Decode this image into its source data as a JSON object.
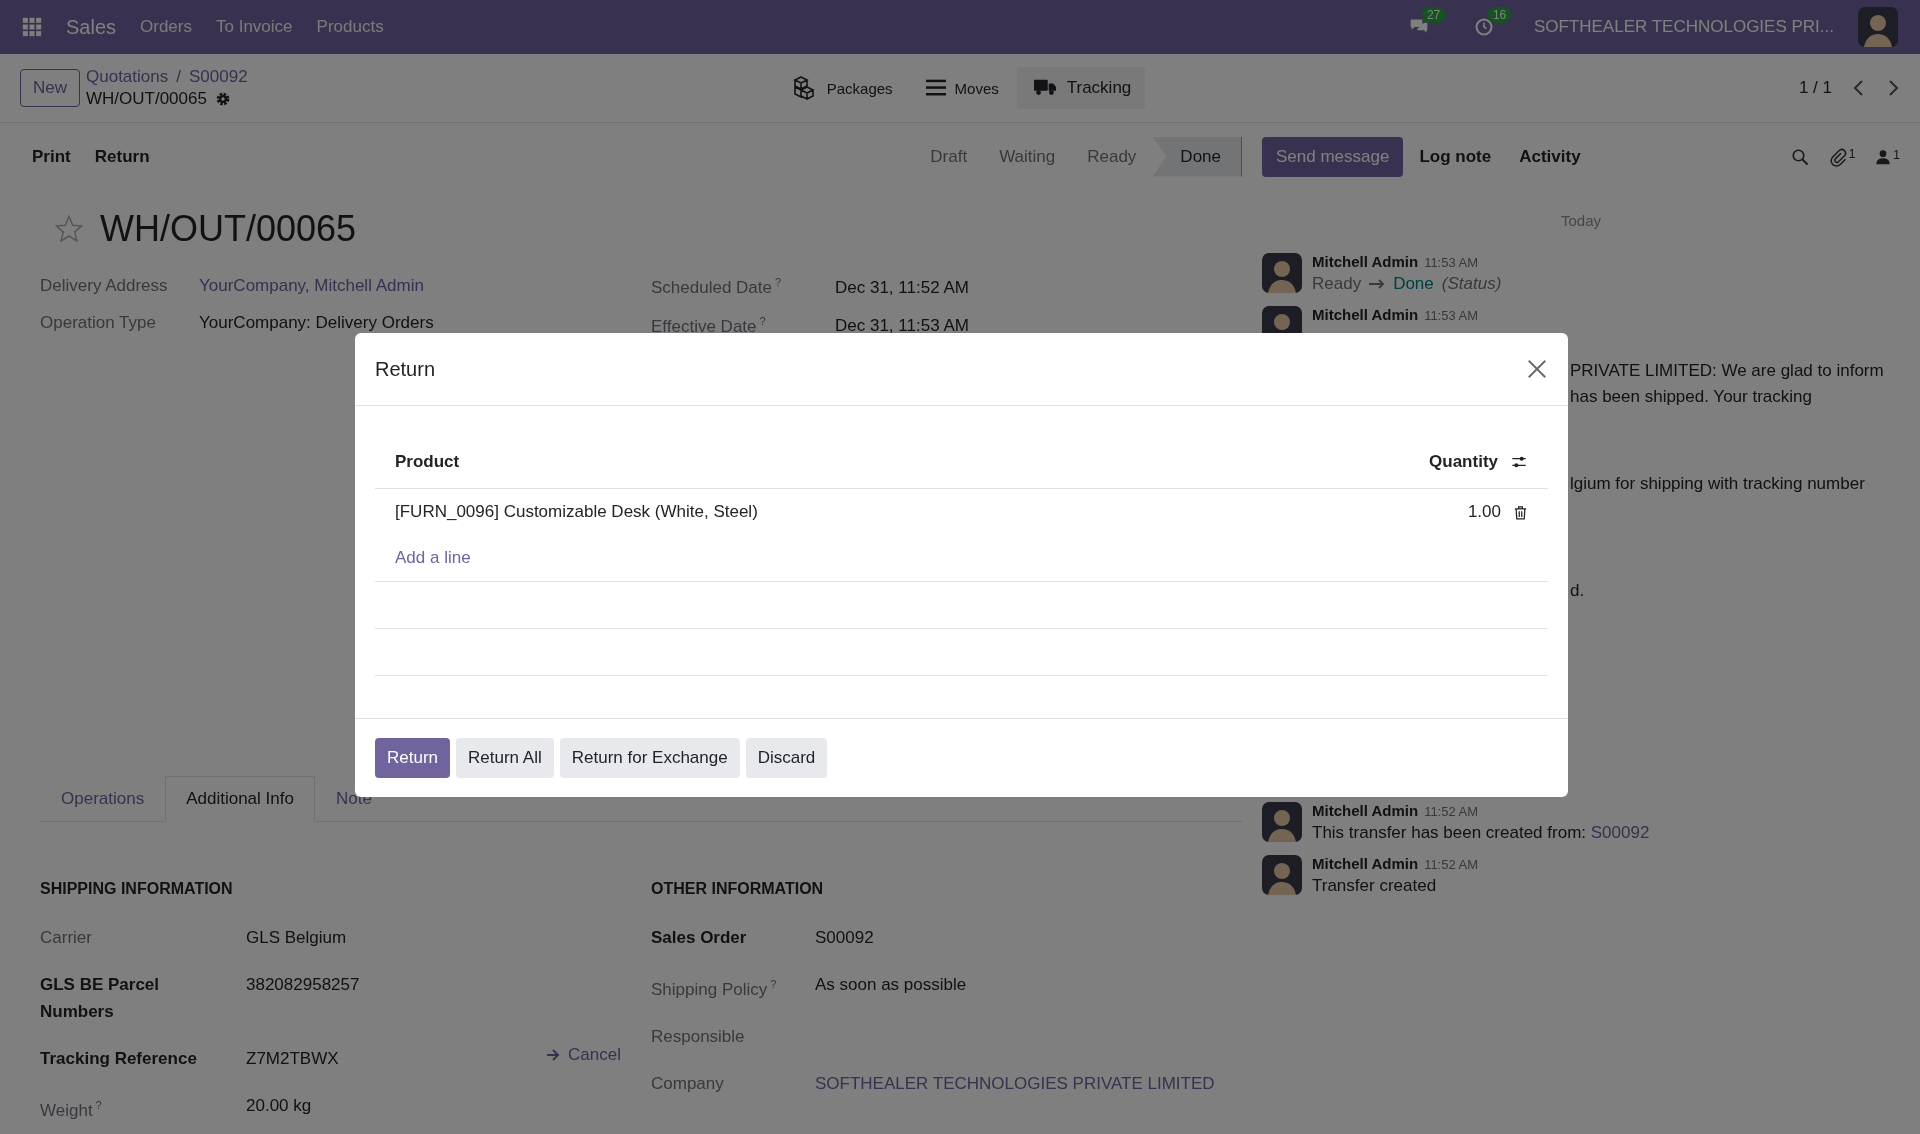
{
  "top_bar": {
    "app": "Sales",
    "menu": [
      "Orders",
      "To Invoice",
      "Products"
    ],
    "messages_badge": "27",
    "activities_badge": "16",
    "company": "SOFTHEALER TECHNOLOGIES PRI..."
  },
  "control_panel": {
    "new_button": "New",
    "breadcrumbs": [
      "Quotations",
      "S00092"
    ],
    "separator": "/",
    "record": "WH/OUT/00065",
    "smart_buttons": [
      {
        "label": "Packages",
        "kind": "packages"
      },
      {
        "label": "Moves",
        "kind": "moves"
      },
      {
        "label": "Tracking",
        "kind": "tracking"
      }
    ],
    "pager": "1 / 1"
  },
  "action_bar": {
    "buttons": [
      "Print",
      "Return"
    ],
    "stages": [
      {
        "label": "Draft",
        "selected": false
      },
      {
        "label": "Waiting",
        "selected": false
      },
      {
        "label": "Ready",
        "selected": false
      },
      {
        "label": "Done",
        "selected": true
      }
    ]
  },
  "chatter_bar": {
    "buttons": [
      {
        "label": "Send message",
        "kind": "primary"
      },
      {
        "label": "Log note",
        "kind": "plain"
      },
      {
        "label": "Activity",
        "kind": "plain"
      }
    ],
    "attachments_count": "1",
    "followers_count": "1"
  },
  "form": {
    "starred": false,
    "title": "WH/OUT/00065",
    "fields_left": [
      {
        "label": "Delivery Address",
        "value": "YourCompany, Mitchell Admin",
        "kind": "link"
      },
      {
        "label": "Operation Type",
        "value": "YourCompany: Delivery Orders",
        "kind": "text"
      }
    ],
    "fields_right": [
      {
        "label": "Scheduled Date",
        "help": "?",
        "value": "Dec 31, 11:52 AM"
      },
      {
        "label": "Effective Date",
        "help": "?",
        "value": "Dec 31, 11:53 AM"
      }
    ]
  },
  "tabs": [
    {
      "label": "Operations",
      "selected": false
    },
    {
      "label": "Additional Info",
      "selected": true
    },
    {
      "label": "Note",
      "selected": false
    }
  ],
  "shipping": {
    "heading": "SHIPPING INFORMATION",
    "fields": [
      {
        "label": "Carrier",
        "value": "GLS Belgium",
        "bold_label": false
      },
      {
        "label": "GLS BE Parcel Numbers",
        "value": "382082958257",
        "bold_label": true
      },
      {
        "label": "Tracking Reference",
        "value": "Z7M2TBWX",
        "bold_label": true,
        "action": "Cancel"
      },
      {
        "label": "Weight",
        "help": "?",
        "value": "20.00 kg",
        "bold_label": false
      }
    ]
  },
  "other": {
    "heading": "OTHER INFORMATION",
    "fields": [
      {
        "label": "Sales Order",
        "value": "S00092",
        "bold_label": true,
        "kind": "text"
      },
      {
        "label": "Shipping Policy",
        "help": "?",
        "value": "As soon as possible",
        "bold_label": false,
        "kind": "text"
      },
      {
        "label": "Responsible",
        "bold_label": false
      },
      {
        "label": "Company",
        "value": "SOFTHEALER TECHNOLOGIES PRIVATE LIMITED",
        "bold_label": false,
        "kind": "link"
      }
    ]
  },
  "chatter": {
    "date": "Today",
    "messages_top": [
      {
        "author": "Mitchell Admin",
        "time": "11:53 AM",
        "kind": "tracking",
        "old": "Ready",
        "new": "Done",
        "field": "(Status)"
      },
      {
        "author": "Mitchell Admin",
        "time": "11:53 AM",
        "kind": "hidden"
      }
    ],
    "fragments": [
      {
        "lines": [
          "PRIVATE LIMITED: We are glad to inform",
          "has been shipped. Your tracking"
        ]
      },
      {
        "lines": [
          "lgium for shipping with tracking number"
        ]
      },
      {
        "lines": [
          "d."
        ]
      }
    ],
    "messages_bottom": [
      {
        "author": "Mitchell Admin",
        "time": "11:52 AM",
        "kind": "link",
        "body": "This transfer has been created from:",
        "link": "S00092"
      },
      {
        "author": "Mitchell Admin",
        "time": "11:52 AM",
        "kind": "text",
        "body": "Transfer created"
      }
    ]
  },
  "dialog": {
    "title": "Return",
    "columns": [
      "Product",
      "Quantity"
    ],
    "rows": [
      {
        "product": "[FURN_0096] Customizable Desk (White, Steel)",
        "quantity": "1.00"
      }
    ],
    "add_line": "Add a line",
    "buttons": [
      {
        "label": "Return",
        "kind": "primary"
      },
      {
        "label": "Return All",
        "kind": "secondary"
      },
      {
        "label": "Return for Exchange",
        "kind": "secondary"
      },
      {
        "label": "Discard",
        "kind": "secondary"
      }
    ]
  }
}
